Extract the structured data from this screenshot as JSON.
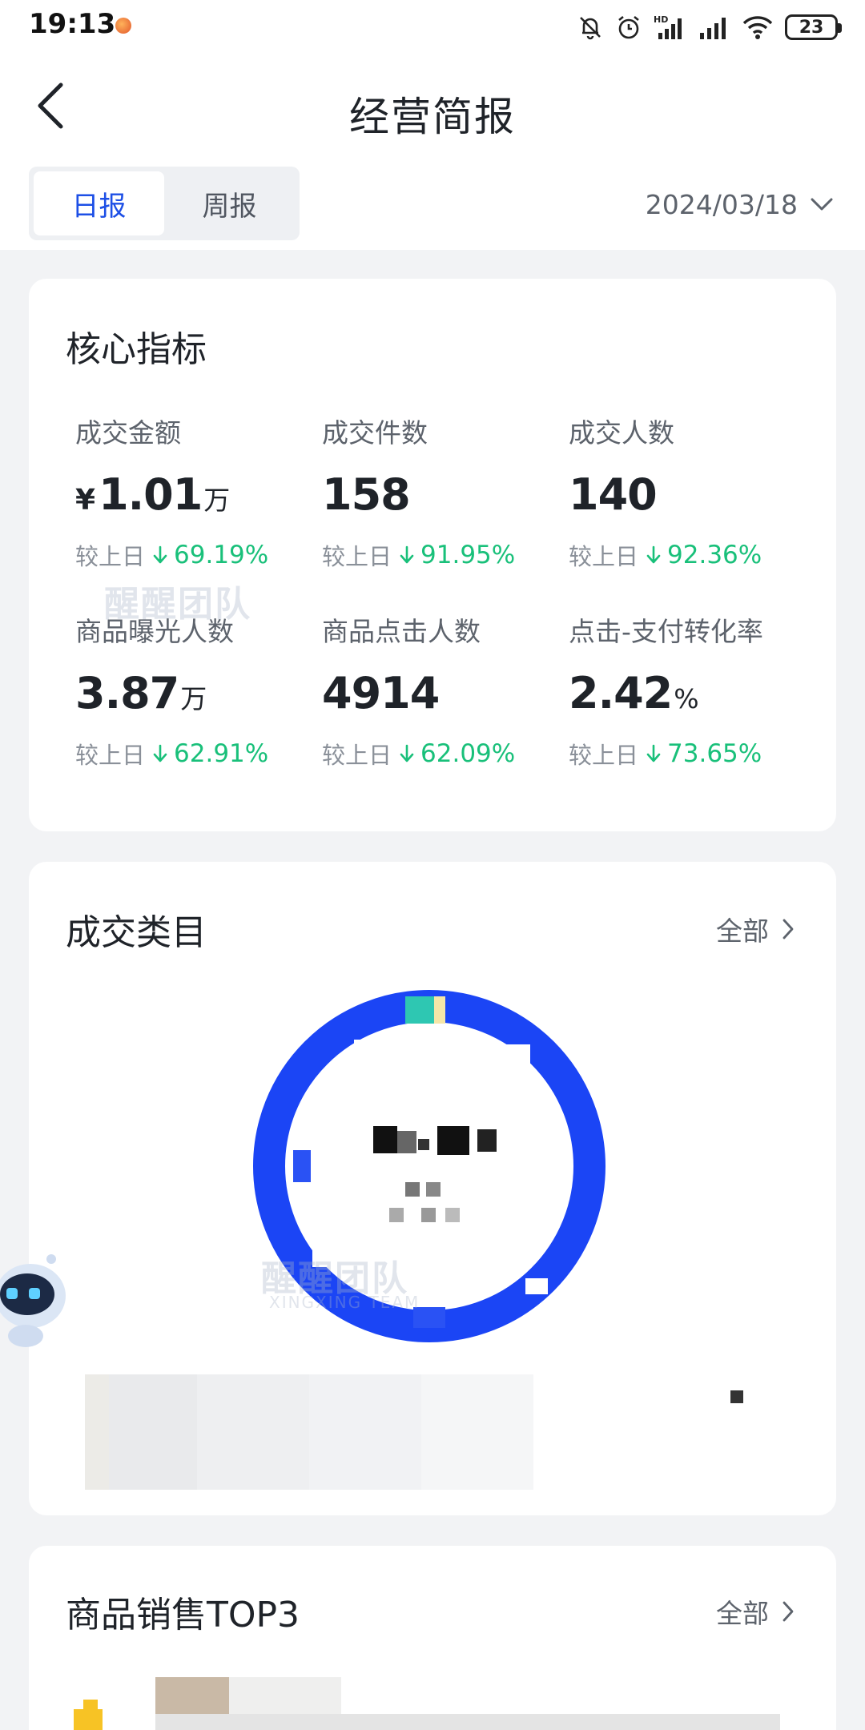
{
  "status_bar": {
    "time": "19:13",
    "battery": "23",
    "icons": [
      "bell-off-icon",
      "alarm-icon",
      "hd-signal-icon",
      "signal-icon",
      "wifi-icon",
      "battery-icon"
    ]
  },
  "nav": {
    "title": "经营简报",
    "back_icon": "chevron-left-icon"
  },
  "tabs": {
    "items": [
      {
        "label": "日报",
        "active": true
      },
      {
        "label": "周报",
        "active": false
      }
    ],
    "date": "2024/03/18",
    "date_icon": "chevron-down-icon"
  },
  "core_metrics": {
    "title": "核心指标",
    "compare_label": "较上日",
    "items": [
      {
        "label": "成交金额",
        "prefix": "¥",
        "value": "1.01",
        "unit": "万",
        "change": "69.19%",
        "direction": "down"
      },
      {
        "label": "成交件数",
        "prefix": "",
        "value": "158",
        "unit": "",
        "change": "91.95%",
        "direction": "down"
      },
      {
        "label": "成交人数",
        "prefix": "",
        "value": "140",
        "unit": "",
        "change": "92.36%",
        "direction": "down"
      },
      {
        "label": "商品曝光人数",
        "prefix": "",
        "value": "3.87",
        "unit": "万",
        "change": "62.91%",
        "direction": "down"
      },
      {
        "label": "商品点击人数",
        "prefix": "",
        "value": "4914",
        "unit": "",
        "change": "62.09%",
        "direction": "down"
      },
      {
        "label": "点击-支付转化率",
        "prefix": "",
        "value": "2.42",
        "unit": "%",
        "change": "73.65%",
        "direction": "down"
      }
    ]
  },
  "category_card": {
    "title": "成交类目",
    "more_label": "全部",
    "colors": {
      "ring": "#1b45f5",
      "accent_teal": "#2ec7b2",
      "accent_yellow": "#f5e6a8"
    }
  },
  "top3_card": {
    "title": "商品销售TOP3",
    "more_label": "全部"
  },
  "watermark": {
    "text": "醒醒团队",
    "sub": "XINGXING TEAM"
  },
  "colors": {
    "accent": "#1d4fe6",
    "down": "#19c07a",
    "background": "#f2f3f5"
  }
}
